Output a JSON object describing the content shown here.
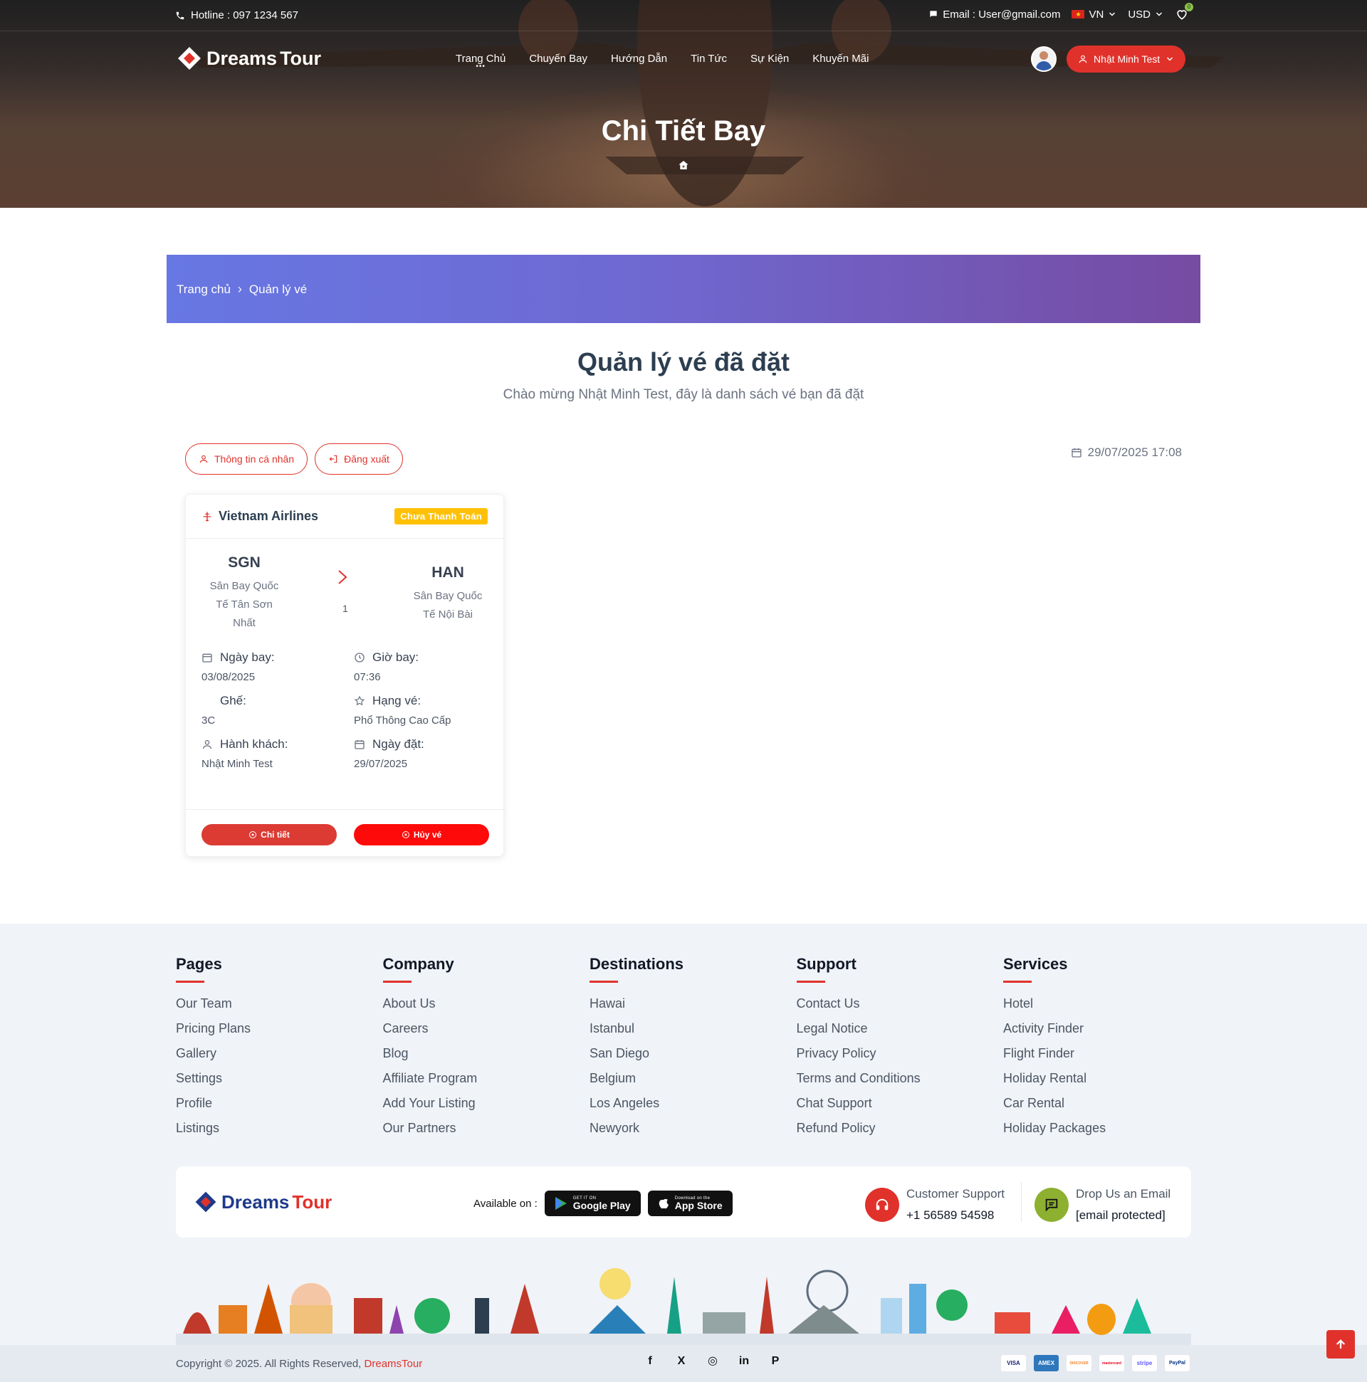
{
  "topbar": {
    "hotline": "Hotline : 097 1234 567",
    "email": "Email : User@gmail.com",
    "language": "VN",
    "currency": "USD",
    "wishlist_count": "0"
  },
  "brand": {
    "part1": "Dreams",
    "part2": "Tour"
  },
  "nav": {
    "links": [
      "Trang Chủ",
      "Chuyến Bay",
      "Hướng Dẫn",
      "Tin Tức",
      "Sự Kiện",
      "Khuyến Mãi"
    ],
    "user_name": "Nhật Minh Test"
  },
  "hero": {
    "title": "Chi Tiết Bay"
  },
  "breadcrumb": {
    "home": "Trang chủ",
    "current": "Quản lý vé"
  },
  "page": {
    "title": "Quản lý vé đã đặt",
    "subtitle": "Chào mừng Nhật Minh Test, đây là danh sách vé bạn đã đặt",
    "profile_button": "Thông tin cá nhân",
    "logout_button": "Đăng xuất",
    "datetime": "29/07/2025 17:08"
  },
  "ticket": {
    "airline": "Vietnam Airlines",
    "status": "Chưa Thanh Toán",
    "from_code": "SGN",
    "from_name_lines": [
      "Sân Bay Quốc",
      "Tế Tân Sơn",
      "Nhất"
    ],
    "to_code": "HAN",
    "to_name_lines": [
      "Sân Bay Quốc",
      "Tế Nội Bài"
    ],
    "stops": "1",
    "fields": {
      "flight_date_label": "Ngày bay:",
      "flight_date": "03/08/2025",
      "flight_time_label": "Giờ bay:",
      "flight_time": "07:36",
      "seat_label": "Ghế:",
      "seat": "3C",
      "class_label": "Hạng vé:",
      "class": "Phổ Thông Cao Cấp",
      "passenger_label": "Hành khách:",
      "passenger": "Nhật Minh Test",
      "booking_date_label": "Ngày đặt:",
      "booking_date": "29/07/2025"
    },
    "detail_button": "Chi tiết",
    "cancel_button": "Hủy vé"
  },
  "footer": {
    "columns": [
      {
        "title": "Pages",
        "items": [
          "Our Team",
          "Pricing Plans",
          "Gallery",
          "Settings",
          "Profile",
          "Listings"
        ]
      },
      {
        "title": "Company",
        "items": [
          "About Us",
          "Careers",
          "Blog",
          "Affiliate Program",
          "Add Your Listing",
          "Our Partners"
        ]
      },
      {
        "title": "Destinations",
        "items": [
          "Hawai",
          "Istanbul",
          "San Diego",
          "Belgium",
          "Los Angeles",
          "Newyork"
        ]
      },
      {
        "title": "Support",
        "items": [
          "Contact Us",
          "Legal Notice",
          "Privacy Policy",
          "Terms and Conditions",
          "Chat Support",
          "Refund Policy"
        ]
      },
      {
        "title": "Services",
        "items": [
          "Hotel",
          "Activity Finder",
          "Flight Finder",
          "Holiday Rental",
          "Car Rental",
          "Holiday Packages"
        ]
      }
    ],
    "available_on": "Available on :",
    "google_play_small": "GET IT ON",
    "google_play": "Google Play",
    "app_store_small": "Download on the",
    "app_store": "App Store",
    "support_label": "Customer Support",
    "support_phone": "+1 56589 54598",
    "email_label": "Drop Us an Email",
    "email_value": "[email protected]",
    "copyright": "Copyright © 2025. All Rights Reserved,",
    "copyright_brand": "DreamsTour",
    "payments": [
      "VISA",
      "AMEX",
      "DISCOVER",
      "mastercard",
      "stripe",
      "PayPal"
    ]
  },
  "colors": {
    "accent": "#e0322b",
    "banner_start": "#6777e3",
    "banner_end": "#764ba2",
    "badge": "#ffc107"
  }
}
